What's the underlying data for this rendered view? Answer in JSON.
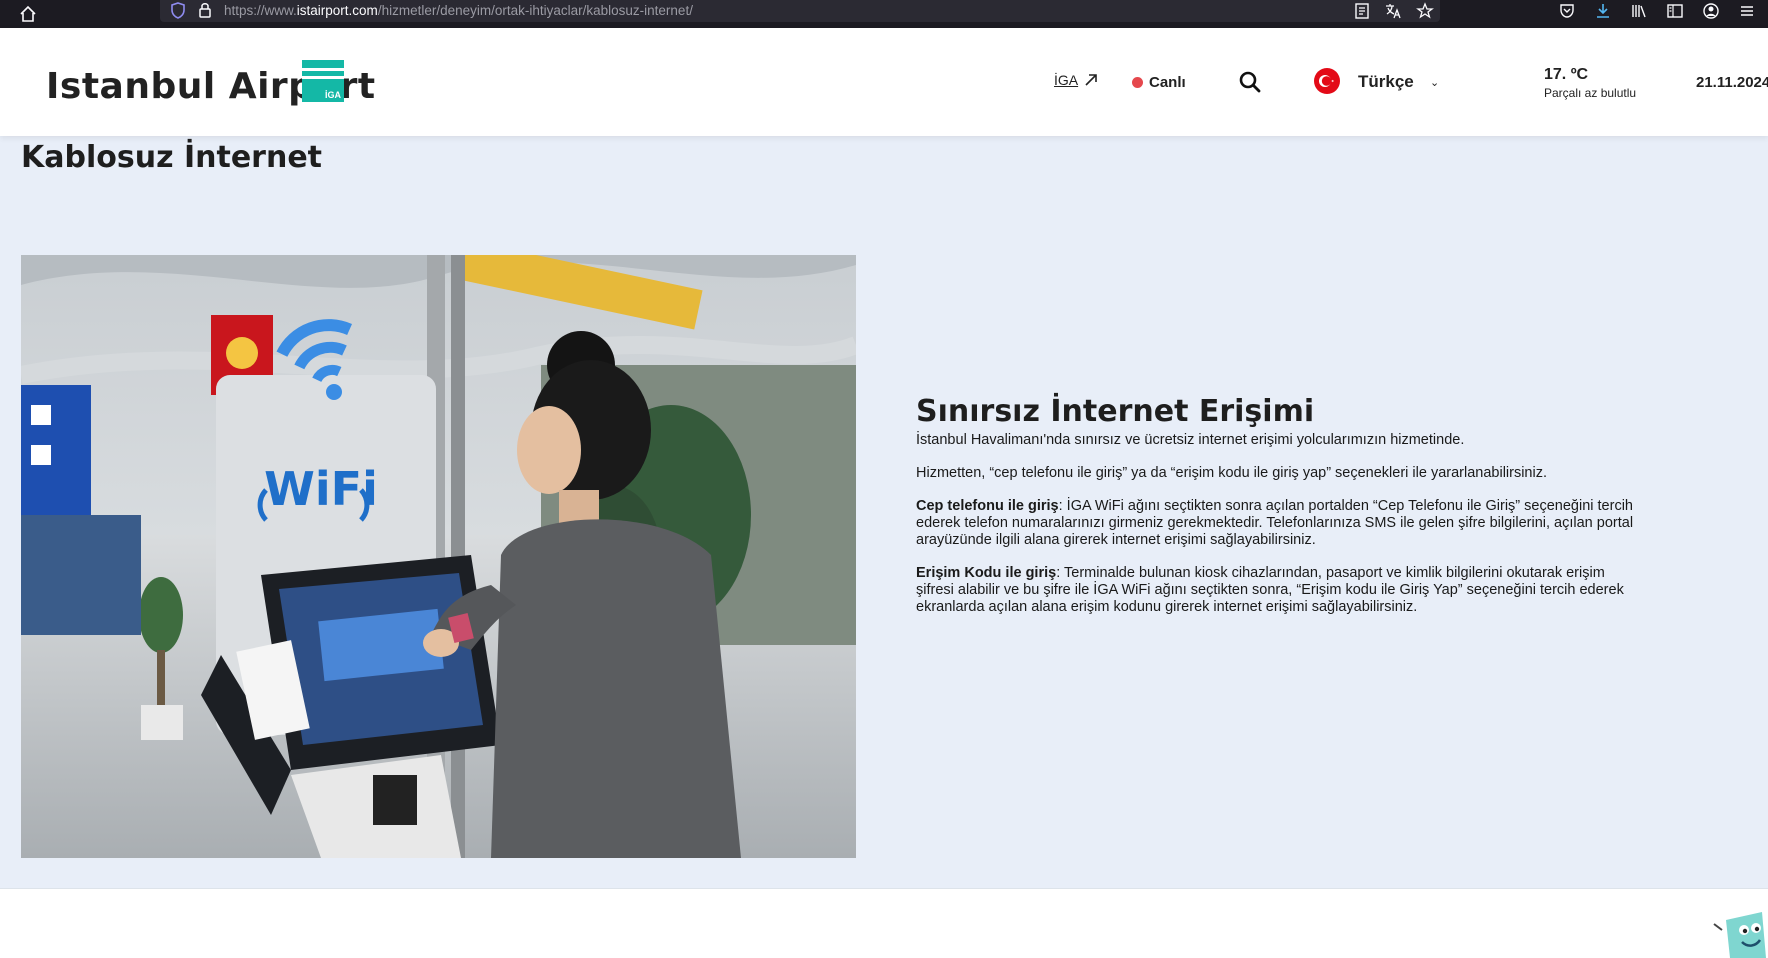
{
  "browser": {
    "url_prefix": "https://www.",
    "url_domain": "istairport.com",
    "url_path": "/hizmetler/deneyim/ortak-ihtiyaclar/kablosuz-internet/"
  },
  "header": {
    "logo_text": "Istanbul Airport",
    "logo_badge": "İGA",
    "nav_iga": "İGA",
    "nav_live": "Canlı",
    "language": "Türkçe",
    "weather_temp": "17. ºC",
    "weather_desc": "Parçalı az bulutlu",
    "date": "21.11.2024"
  },
  "page": {
    "title": "Kablosuz İnternet"
  },
  "photo": {
    "sign_text": "WiFi"
  },
  "info": {
    "heading": "Sınırsız İnternet Erişimi",
    "p1": "İstanbul Havalimanı'nda sınırsız ve ücretsiz internet erişimi yolcularımızın hizmetinde.",
    "p2": "Hizmetten, “cep telefonu ile giriş” ya da “erişim kodu ile giriş yap” seçenekleri ile yararlanabilirsiniz.",
    "p3_bold": "Cep telefonu ile giriş",
    "p3_text": ": İGA WiFi ağını seçtikten sonra açılan portalden “Cep Telefonu ile Giriş” seçeneğini tercih ederek telefon numaralarınızı girmeniz gerekmektedir. Telefonlarınıza SMS ile gelen şifre bilgilerini, açılan portal arayüzünde ilgili alana girerek internet erişimi sağlayabilirsiniz.",
    "p4_bold": "Erişim Kodu ile giriş",
    "p4_text": ": Terminalde bulunan kiosk cihazlarından, pasaport ve kimlik bilgilerini okutarak erişim şifresi alabilir ve bu şifre ile İGA WiFi ağını seçtikten sonra, “Erişim kodu ile Giriş Yap” seçeneğini tercih ederek ekranlarda açılan alana erişim kodunu girerek internet erişimi sağlayabilirsiniz."
  },
  "colors": {
    "accent": "#14b8a6",
    "live": "#e5484d",
    "content_bg": "#e8eef8"
  }
}
